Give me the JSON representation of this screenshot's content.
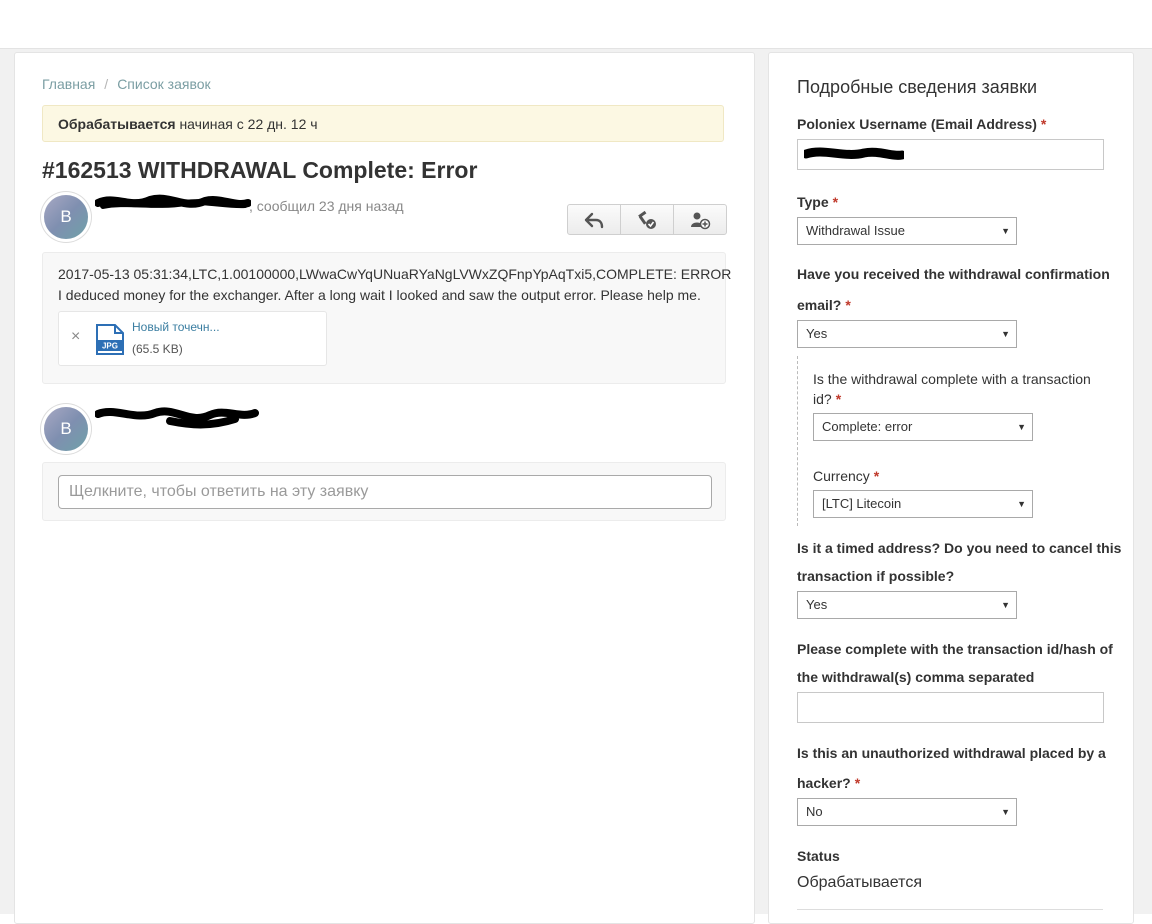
{
  "breadcrumb": {
    "home": "Главная",
    "separator": "/",
    "list": "Список заявок"
  },
  "status_banner": {
    "status": "Обрабатывается",
    "since": "начиная с 22 дн. 12 ч"
  },
  "ticket": {
    "title": "#162513 WITHDRAWAL Complete: Error",
    "reported_text": ", сообщил 23 дня назад",
    "avatar_letter": "B",
    "message_line1": "2017-05-13 05:31:34,LTC,1.00100000,LWwaCwYqUNuaRYaNgLVWxZQFnpYpAqTxi5,COMPLETE: ERROR",
    "message_line2": "I deduced money for the exchanger. After a long wait I looked and saw the output error. Please help me.",
    "attachment": {
      "remove_symbol": "×",
      "icon_label": "JPG",
      "name": "Новый точечн...",
      "size": "(65.5 KB)"
    }
  },
  "actions": {
    "icons": [
      "reply-icon",
      "resolve-icon",
      "add-user-icon"
    ]
  },
  "reply": {
    "avatar_letter": "B",
    "placeholder": "Щелкните, чтобы ответить на эту заявку"
  },
  "details": {
    "title": "Подробные сведения заявки",
    "required_mark": "*",
    "username_label": "Poloniex Username (Email Address)",
    "type_label": "Type",
    "type_value": "Withdrawal Issue",
    "confirm_label_1": "Have you received the withdrawal confirmation",
    "confirm_label_2": "email?",
    "confirm_value": "Yes",
    "txid_label_1": "Is the withdrawal complete with a transaction",
    "txid_label_2": "id?",
    "txid_value": "Complete: error",
    "currency_label": "Currency",
    "currency_value": "[LTC] Litecoin",
    "timed_label_1": "Is it a timed address? Do you need to cancel this",
    "timed_label_2": "transaction if possible?",
    "timed_value": "Yes",
    "hash_label_1": "Please complete with the transaction id/hash of",
    "hash_label_2": "the withdrawal(s) comma separated",
    "unauth_label_1": "Is this an unauthorized withdrawal placed by a",
    "unauth_label_2": "hacker?",
    "unauth_value": "No",
    "status_label": "Status",
    "status_value": "Обрабатывается"
  },
  "colors": {
    "banner_bg": "#fcf8e3",
    "link": "#7b9ea3",
    "required": "#c0392b",
    "file_icon": "#2d6fb5"
  }
}
